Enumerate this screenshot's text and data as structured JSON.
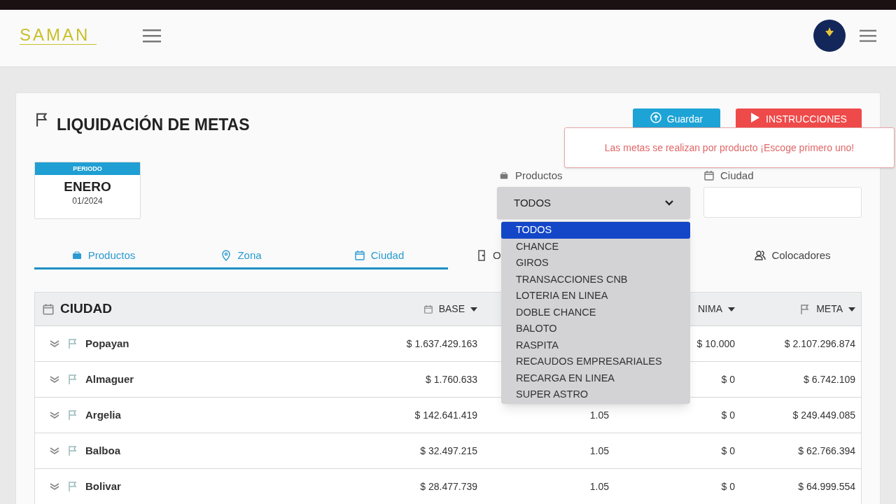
{
  "header": {
    "logo": "SAMAN"
  },
  "page": {
    "title": "LIQUIDACIÓN DE METAS",
    "buttons": [
      {
        "label": "Guardar",
        "kind": "save"
      },
      {
        "label": "INSTRUCCIONES",
        "kind": "play"
      }
    ]
  },
  "toast": {
    "message": "Las metas se realizan por producto ¡Escoge primero uno!"
  },
  "period": {
    "label": "PERIODO",
    "month": "ENERO",
    "date": "01/2024"
  },
  "filters": {
    "productos": {
      "label": "Productos",
      "value": "TODOS",
      "expanded": true,
      "options": [
        {
          "label": "TODOS",
          "selected": true
        },
        {
          "label": "CHANCE",
          "selected": false
        },
        {
          "label": "GIROS",
          "selected": false
        },
        {
          "label": "TRANSACCIONES CNB",
          "selected": false
        },
        {
          "label": "LOTERIA EN LINEA",
          "selected": false
        },
        {
          "label": "DOBLE CHANCE",
          "selected": false
        },
        {
          "label": "BALOTO",
          "selected": false
        },
        {
          "label": "RASPITA",
          "selected": false
        },
        {
          "label": "RECAUDOS EMPRESARIALES",
          "selected": false
        },
        {
          "label": "RECARGA EN LINEA",
          "selected": false
        },
        {
          "label": "SUPER ASTRO",
          "selected": false
        }
      ]
    },
    "ciudad": {
      "label": "Ciudad"
    }
  },
  "tabs": [
    {
      "label": "Productos",
      "selected": false,
      "kind": "cart"
    },
    {
      "label": "Zona",
      "selected": false,
      "kind": "pin"
    },
    {
      "label": "Ciudad",
      "selected": true,
      "kind": "calendar"
    },
    {
      "label": "O",
      "selected": false,
      "kind": "door"
    },
    {
      "label": "Colocadores",
      "selected": false,
      "kind": "people"
    }
  ],
  "table": {
    "columns": [
      {
        "label": "CIUDAD"
      },
      {
        "label": "BASE"
      },
      {},
      {
        "label": "NIMA"
      },
      {
        "label": "META"
      }
    ],
    "rows": [
      {
        "ciudad": "Popayan",
        "base": "$ 1.637.429.163",
        "column_4": "$ 10.000",
        "meta": "$ 2.107.296.874"
      },
      {
        "ciudad": "Almaguer",
        "base": "$ 1.760.633",
        "column_4": "$ 0",
        "meta": "$ 6.742.109"
      },
      {
        "ciudad": "Argelia",
        "base": "$ 142.641.419",
        "column_3": "1.05",
        "column_4": "$ 0",
        "meta": "$ 249.449.085"
      },
      {
        "ciudad": "Balboa",
        "base": "$ 32.497.215",
        "column_3": "1.05",
        "column_4": "$ 0",
        "meta": "$ 62.766.394"
      },
      {
        "ciudad": "Bolivar",
        "base": "$ 28.477.739",
        "column_3": "1.05",
        "column_4": "$ 0",
        "meta": "$ 64.999.554"
      }
    ]
  }
}
